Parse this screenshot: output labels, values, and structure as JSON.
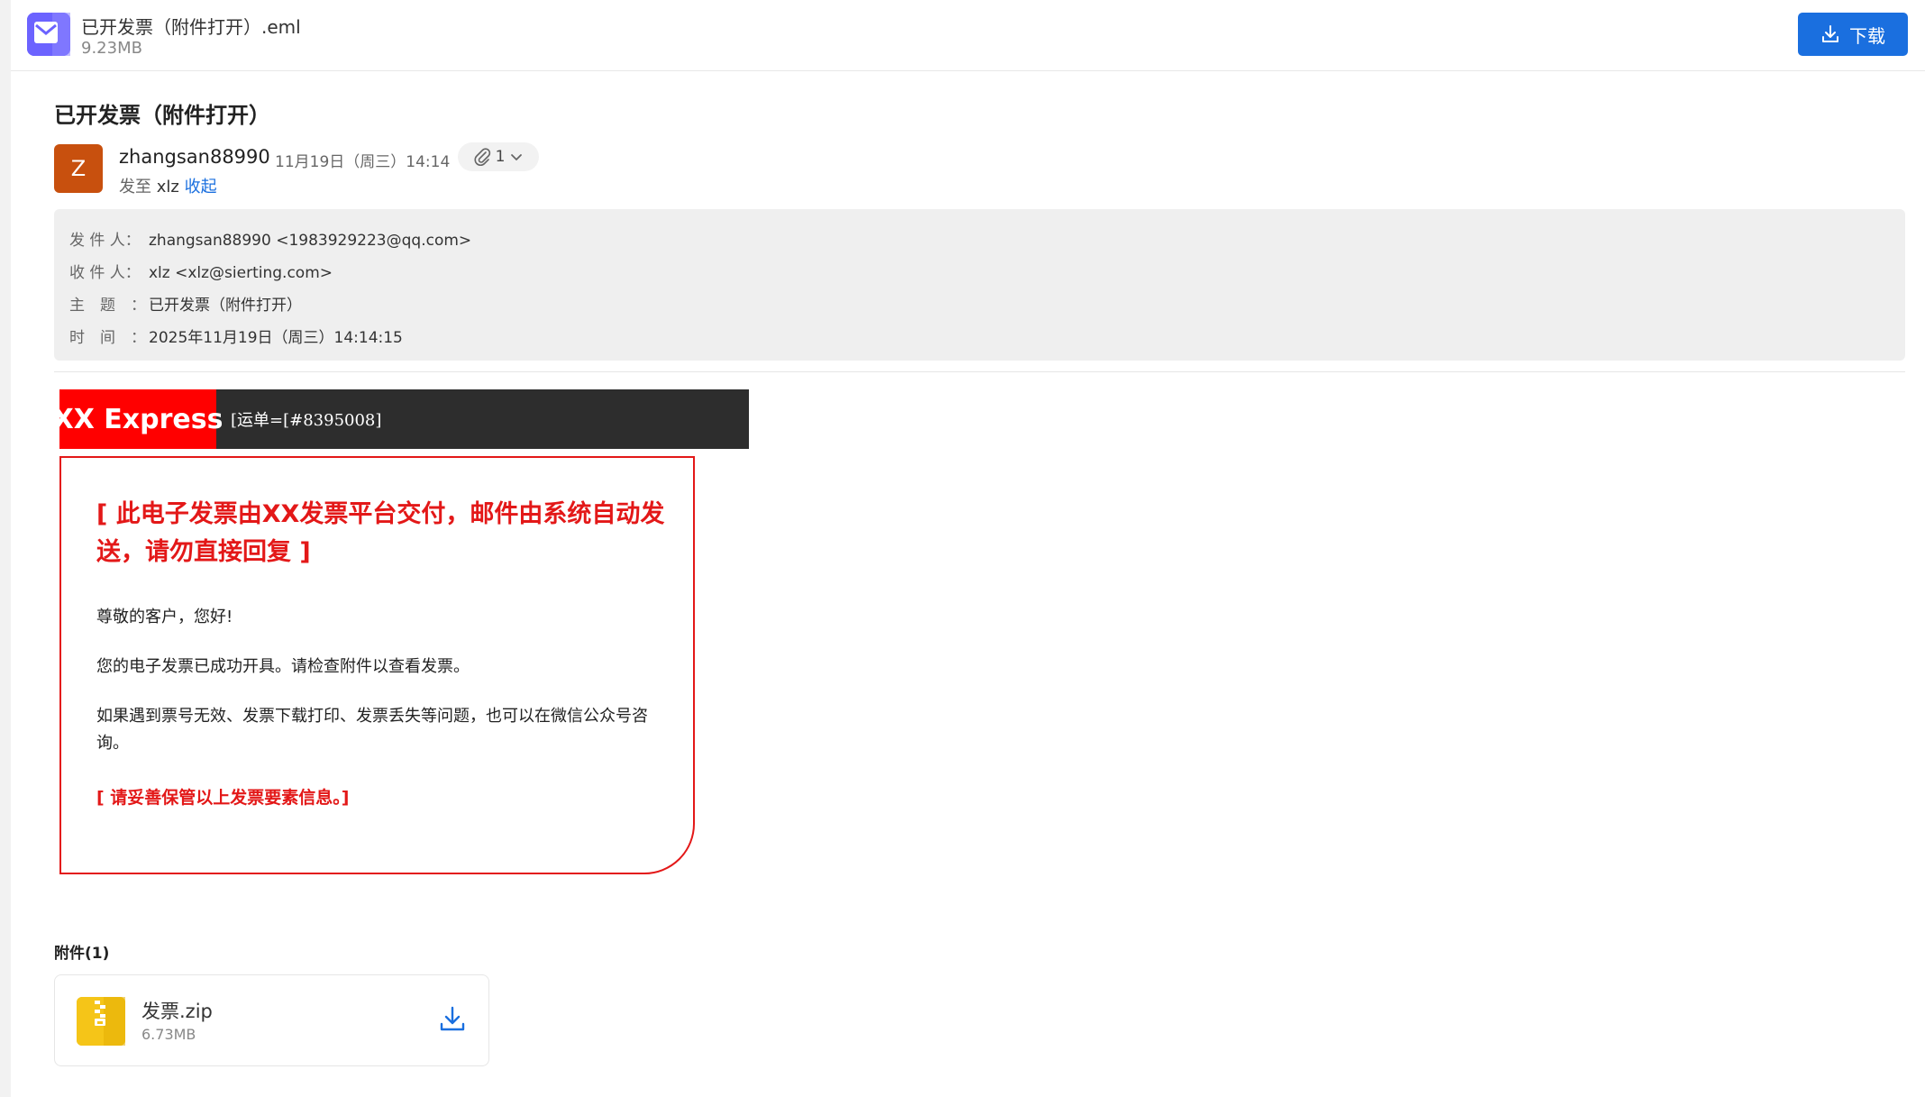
{
  "colors": {
    "primary": "#1a6fdf",
    "alert_red": "#e31818",
    "avatar_bg": "#c8500e",
    "banner_dark": "#2d2d2d"
  },
  "header": {
    "file_icon": "mail-icon",
    "file_name": "已开发票（附件打开）.eml",
    "file_size": "9.23MB",
    "download_label": "下载"
  },
  "email": {
    "subject": "已开发票（附件打开）",
    "avatar_letter": "Z",
    "sender_name": "zhangsan88990",
    "sent_time": "11月19日（周三）14:14",
    "attachment_count": "1",
    "to_prefix": "发至",
    "to_name": "xlz",
    "collapse_label": "收起",
    "meta": [
      {
        "label": "发 件 人：",
        "value": "zhangsan88990 <1983929223@qq.com>"
      },
      {
        "label": "收 件 人：",
        "value": "xlz <xlz@sierting.com>"
      },
      {
        "label": "主　题　：",
        "value": "已开发票（附件打开）"
      },
      {
        "label": "时　间　：",
        "value": "2025年11月19日（周三）14:14:15"
      }
    ]
  },
  "body": {
    "brand": "XX Express",
    "tracking": "[运单=[#8395008]",
    "notice_title": "[ 此电子发票由XX发票平台交付，邮件由系统自动发送，请勿直接回复 ]",
    "greeting": "尊敬的客户，您好!",
    "line1": "您的电子发票已成功开具。请检查附件以查看发票。",
    "line2": "如果遇到票号无效、发票下载打印、发票丢失等问题，也可以在微信公众号咨询。",
    "footer_notice": "[ 请妥善保管以上发票要素信息。]"
  },
  "attachments": {
    "heading": "附件(1)",
    "items": [
      {
        "name": "发票.zip",
        "size": "6.73MB",
        "icon": "zip-file-icon"
      }
    ]
  }
}
